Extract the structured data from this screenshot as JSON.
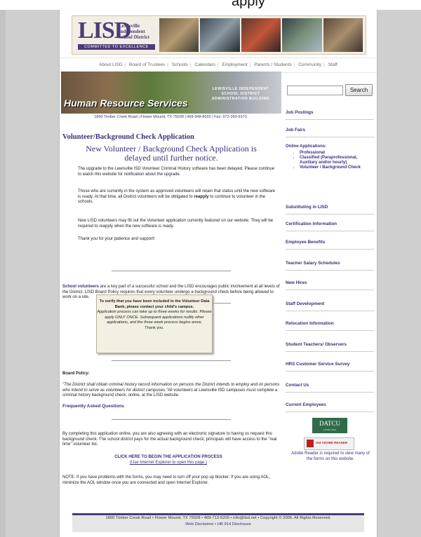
{
  "top_fragment": "apply",
  "logo": {
    "letters": "LISD",
    "name_lines": [
      "Lewisville",
      "Independent",
      "School District"
    ],
    "tagline": "COMMITTED TO EXCELLENCE"
  },
  "nav": {
    "items": [
      "About LISD",
      "Board of Trustees",
      "Schools",
      "Calendars",
      "Employment",
      "Parents / Students",
      "Community",
      "Staff"
    ]
  },
  "hero": {
    "title": "Human Resource Services",
    "school_sign": "LEWISVILLE INDEPENDENT SCHOOL DISTRICT ADMINISTRATION BUILDING",
    "address_bar": "1800 Timber Creek Road | Flower Mound, TX 75028 | 469-948-8032 | Fax: 972-350-9373"
  },
  "main": {
    "heading": "Volunteer/Background Check Application",
    "notice": "New Volunteer / Background Check Application is delayed until further notice.",
    "para1": "The upgrade to the Lewisville ISD Volunteer Criminal History software has been delayed. Please continue to watch this website for notification about the upgrade.",
    "para2_a": "Those who are currently in the system as approved volunteers will retain that status until the new software is ready. At that time, all District volunteers will be obligated to ",
    "para2_b": "reapply",
    "para2_c": " to continue to volunteer in the schools.",
    "para3": "New LISD volunteers may fill out the Volunteer application currently featured on our website. They will be required to reapply when the new software is ready.",
    "para4": "Thank you for your patience and support!",
    "volunteers_lead": "School volunteers",
    "volunteers_text": " are a key part of a successful school and the LISD encourages public involvement at all levels of the District. LISD Board Policy requires that every volunteer undergo a background check before being allowed to work on a site.",
    "verify_bold": "To verify that you have been included in the Volunteer Data Bank, please contact your child's campus.",
    "verify_italic": "Application process can take up to three weeks for results. Please apply ONLY ONCE. Subsequent applications nullify other applications, and the three week process begins anew.",
    "verify_thanks": "Thank you.",
    "board_label": "Board Policy:",
    "board_quote": "\"The District shall obtain criminal history record information on persons the District intends to employ and on persons who intend to serve as volunteers for district campuses.\"",
    "board_text_a": "All volunteers at Lewisville ISD campuses ",
    "board_text_must": "must",
    "board_text_b": " complete a criminal history background check, online, at the LISD website.",
    "faq": "Frequently Asked Questions",
    "consent": "By completing this application online, you are also agreeing with an electronic signature to having us request this background check. The school district pays for the actual background check; principals will have access to the \"real time\" volunteer list.",
    "click_here": "CLICK HERE TO BEGIN THE APPLICATION PROCESS",
    "click_here_sub": "(Use Internet Explorer to open this page.)",
    "note": "NOTE: If you have problems with the forms, you may need to turn off your pop up blocker. If you are using AOL, minimize the AOL window once you are connected and open Internet Explorer."
  },
  "sidebar": {
    "search_button": "Search",
    "links": [
      "Job Postings",
      "Job Fairs"
    ],
    "online_apps_title": "Online Applications:",
    "online_apps": [
      "Professional",
      "Classified (Paraprofessional, Auxiliary and/or hourly)",
      "Volunteer / Background Check"
    ],
    "links2": [
      "Substituting in LISD",
      "Certification Information",
      "Employee Benefits",
      "Teacher Salary Schedules",
      "New Hires",
      "Staff Development",
      "Relocation Information",
      "Student Teachers/ Observers",
      "HRS Customer Service Survey",
      "Contact Us",
      "Current Employees"
    ],
    "datcu": "DATCU",
    "datcu_sub": "Credit Union",
    "adobe_get": "Get ADOBE READER",
    "adobe_note": "Adobe Reader is required to view many of the forms on this website."
  },
  "footer": {
    "line1": "1800 Timber Creek Road • Flower Mound, TX 75028 • 469-713-5200 • info@lisd.net • Copyright © 2006. All Rights Reserved.",
    "line2": "Web Disclaimer • HB 914 Disclosure"
  },
  "colors": {
    "accent": "#3c2f7a",
    "background": "#cfcfcf",
    "datcu": "#2f6b4a",
    "adobe": "#c21d1d"
  }
}
